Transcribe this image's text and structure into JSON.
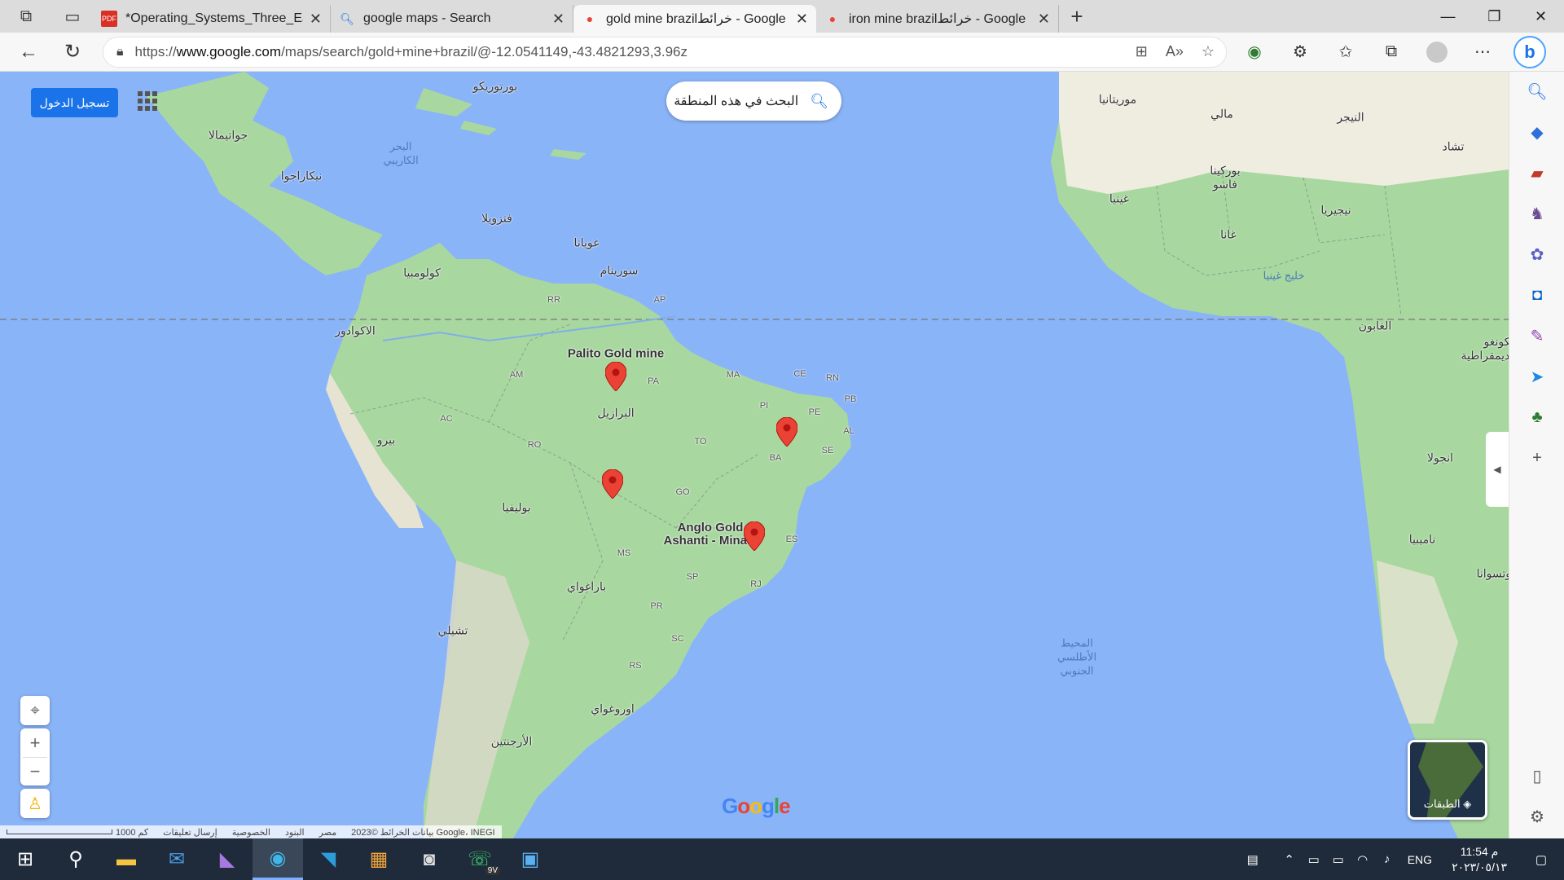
{
  "tabs": [
    {
      "title": "*Operating_Systems_Three_Easy_",
      "icon": "pdf-icon",
      "active": false
    },
    {
      "title": "google maps - Search",
      "icon": "search-icon",
      "active": false
    },
    {
      "title": "gold mine brazil‎خرائط - Google",
      "icon": "maps-pin-icon",
      "active": true
    },
    {
      "title": "iron mine brazil‎خرائط - Google",
      "icon": "maps-pin-icon",
      "active": false
    }
  ],
  "address": {
    "scheme": "https://",
    "host": "www.google.com",
    "path": "/maps/search/gold+mine+brazil/@-12.0541149,-43.4821293,3.96z"
  },
  "maps": {
    "signin_label": "تسجيل الدخول",
    "search_label": "البحث في هذه المنطقة",
    "layers_label": "الطبقات",
    "logo": "Google",
    "attribution": [
      "بيانات الخرائط ©2023 Google، INEGI",
      "مصر",
      "البنود",
      "الخصوصية",
      "إرسال تعليقات",
      "1000 كم"
    ],
    "pins": [
      {
        "label": "Palito Gold mine"
      },
      {
        "label": ""
      },
      {
        "label": ""
      },
      {
        "label": "Anglo Gold\nAshanti - Mina..."
      }
    ],
    "place_labels": {
      "puerto_rico": "بورتوريكو",
      "guatemala": "جواتيمالا",
      "nicaragua": "نيكاراجوا",
      "caribbean": "البحر\nالكاريبي",
      "venezuela": "فنزويلا",
      "guyana": "غويانا",
      "suriname": "سورينام",
      "colombia": "كولومبيا",
      "ecuador": "الاكوادور",
      "peru": "بيرو",
      "brazil": "البرازيل",
      "bolivia": "بوليفيا",
      "paraguay": "باراغواي",
      "chile": "تشيلي",
      "uruguay": "اوروغواي",
      "argentina": "الأرجنتين",
      "mauritania": "موريتانيا",
      "mali": "مالي",
      "niger": "النيجر",
      "chad": "تشاد",
      "burkina": "بوركينا\nفاسو",
      "guinea": "غينيا",
      "ghana": "غانا",
      "nigeria": "نيجيريا",
      "gulf_guinea": "خليج غينيا",
      "gabon": "الغابون",
      "congo": "الكونغو\nالديمقراطية",
      "angola": "انجولا",
      "namibia": "ناميبيا",
      "botswana": "بوتسوانا",
      "south_atlantic": "المحيط\nالأطلسي\nالجنوبي"
    },
    "state_labels": {
      "rr": "RR",
      "ap": "AP",
      "am": "AM",
      "pa": "PA",
      "ma": "MA",
      "ce": "CE",
      "rn": "RN",
      "pb": "PB",
      "pi": "PI",
      "pe": "PE",
      "al": "AL",
      "se": "SE",
      "to": "TO",
      "ba": "BA",
      "ac": "AC",
      "ro": "RO",
      "mt_go": "GO",
      "ms": "MS",
      "mg_es": "ES",
      "sp": "SP",
      "rj": "RJ",
      "pr": "PR",
      "sc": "SC",
      "rs": "RS"
    }
  },
  "taskbar": {
    "apps": [
      "start-icon",
      "search-icon",
      "file-explorer-icon",
      "mail-icon",
      "visual-studio-icon",
      "edge-icon",
      "vscode-icon",
      "store-icon",
      "camera-icon",
      "whatsapp-icon",
      "photos-icon"
    ],
    "language": "ENG",
    "time": "11:54 م",
    "date": "٢٠٢٣/٠٥/١٣",
    "whatsapp_badge": "9V"
  }
}
